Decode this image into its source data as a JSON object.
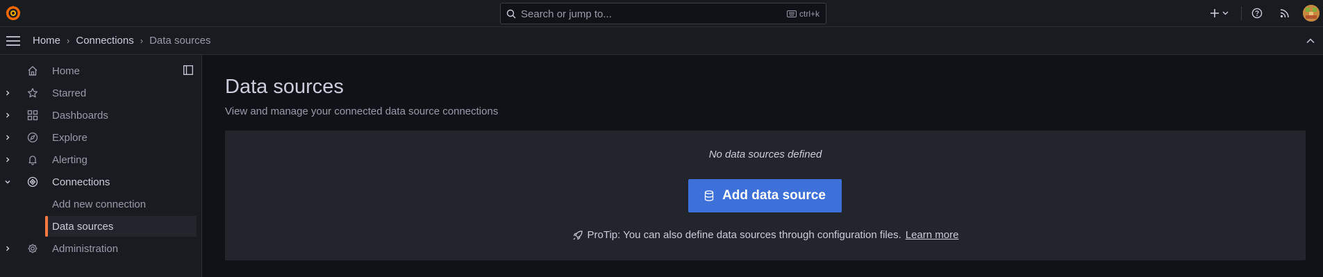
{
  "topbar": {
    "search_placeholder": "Search or jump to...",
    "search_shortcut": "ctrl+k"
  },
  "breadcrumb": [
    "Home",
    "Connections",
    "Data sources"
  ],
  "sidebar": {
    "items": [
      {
        "label": "Home",
        "icon": "home-icon",
        "expandable": false
      },
      {
        "label": "Starred",
        "icon": "star-icon",
        "expandable": true
      },
      {
        "label": "Dashboards",
        "icon": "apps-icon",
        "expandable": true
      },
      {
        "label": "Explore",
        "icon": "compass-icon",
        "expandable": true
      },
      {
        "label": "Alerting",
        "icon": "bell-icon",
        "expandable": true
      },
      {
        "label": "Connections",
        "icon": "connections-icon",
        "expandable": true,
        "open": true
      },
      {
        "label": "Administration",
        "icon": "cog-icon",
        "expandable": true
      }
    ],
    "connections_children": [
      {
        "label": "Add new connection",
        "active": false
      },
      {
        "label": "Data sources",
        "active": true
      }
    ]
  },
  "main": {
    "title": "Data sources",
    "subtitle": "View and manage your connected data source connections",
    "empty_message": "No data sources defined",
    "add_button_label": "Add data source",
    "protip_text": "ProTip: You can also define data sources through configuration files.",
    "protip_link": "Learn more"
  },
  "colors": {
    "accent_blue": "#3d71d9",
    "active_orange": "#ff7941",
    "background": "#111217",
    "panel": "#181b1f"
  }
}
